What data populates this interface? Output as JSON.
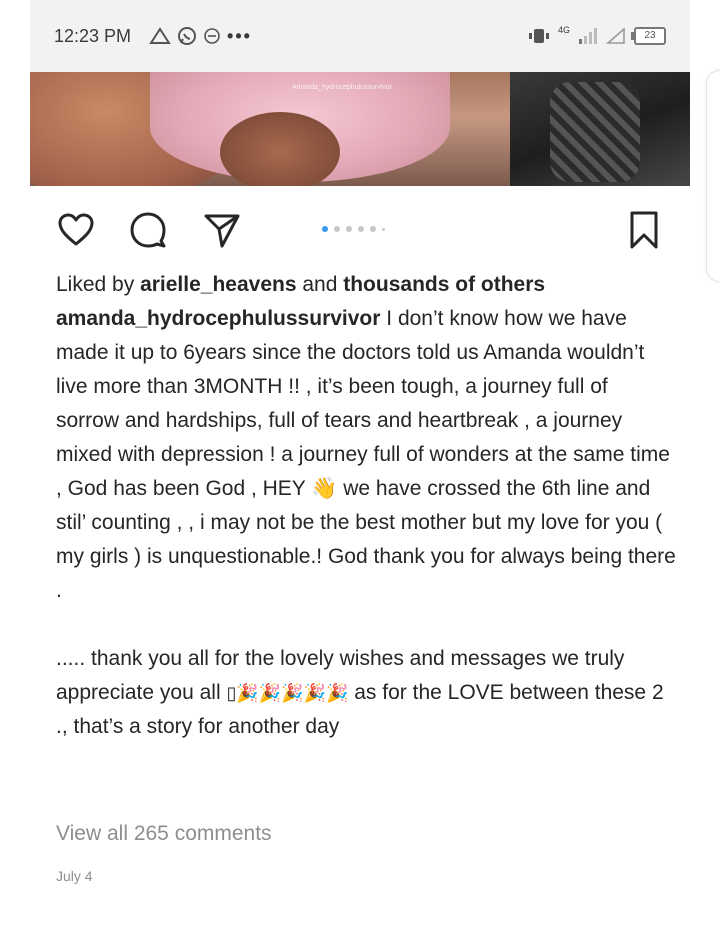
{
  "status_bar": {
    "time": "12:23 PM",
    "network_label": "4G",
    "battery": "23",
    "icons": [
      "alert-triangle-icon",
      "whatsapp-icon",
      "dnd-icon",
      "more-dots-icon"
    ]
  },
  "photo": {
    "watermark": "Amanda_hydrocephulussurvivor"
  },
  "actions": {
    "icons": [
      "heart-icon",
      "comment-icon",
      "share-icon",
      "bookmark-icon"
    ],
    "carousel_total": 6,
    "carousel_active": 1
  },
  "post": {
    "likes_prefix": "Liked by ",
    "likes_user": "arielle_heavens",
    "likes_mid": " and ",
    "likes_others": "thousands of others",
    "username": "amanda_hydrocephulussurvivor",
    "caption_main": " I don’t know how we have made it up to 6years since the doctors told us Amanda wouldn’t live more than 3MONTH !! , it’s been tough, a journey full of sorrow and hardships, full of tears and heartbreak , a journey mixed with depression !  a journey full of wonders at the same time , God has been God , HEY 👋 we have crossed the 6th line and stil’ counting , , i may not be the best mother but my love for you ( my girls ) is unquestionable.! God thank you for always being there .",
    "caption_second_a": "..... thank you all for the lovely wishes and messages we truly appreciate you all ",
    "caption_second_emoji": "▯🎉🎉🎉🎉🎉",
    "caption_second_b": " as for the LOVE between these 2 ., that’s a story for another day",
    "view_comments": "View all 265 comments",
    "date": "July 4"
  },
  "colors": {
    "accent_dot": "#3897f0",
    "text": "#262626",
    "muted": "#8e8e8e"
  }
}
